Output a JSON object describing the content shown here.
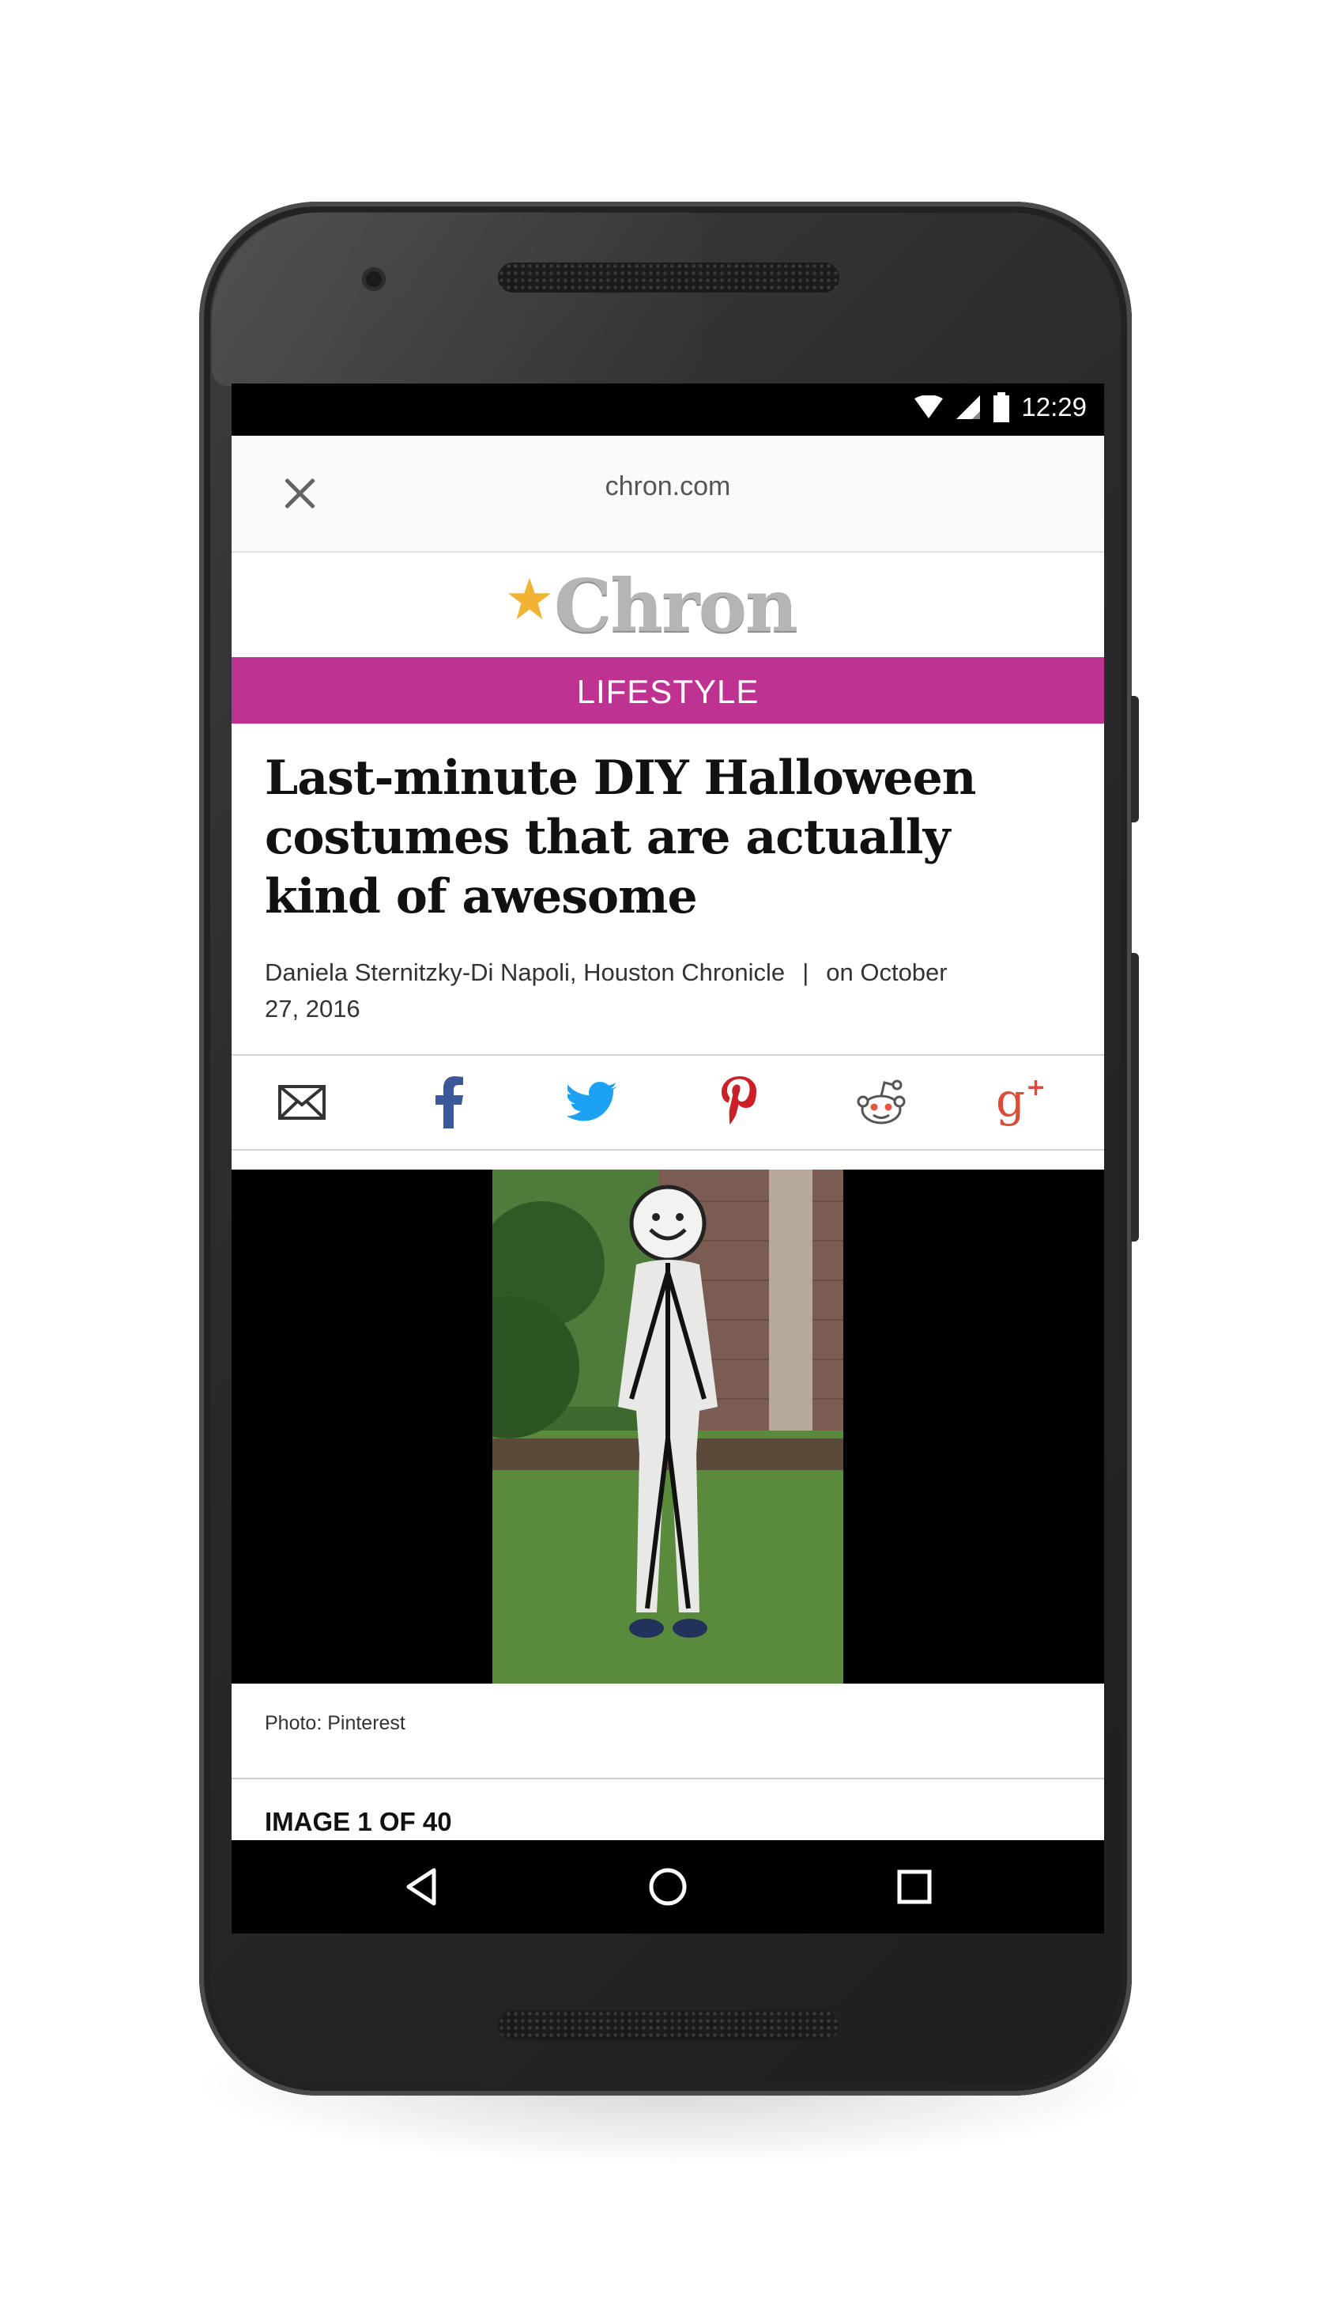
{
  "status_bar": {
    "time": "12:29"
  },
  "browser": {
    "url": "chron.com"
  },
  "site": {
    "logo_text": "Chron",
    "section": "LIFESTYLE",
    "section_color": "#be3391"
  },
  "article": {
    "headline": "Last-minute DIY Halloween costumes that are actually kind of awesome",
    "author": "Daniela Sternitzky-Di Napoli, Houston Chronicle",
    "separator": "|",
    "date_prefix": "on October",
    "date_rest": "27, 2016"
  },
  "share": [
    {
      "icon": "email-icon",
      "color": "#333333"
    },
    {
      "icon": "facebook-icon",
      "color": "#3b5998"
    },
    {
      "icon": "twitter-icon",
      "color": "#1da1f2"
    },
    {
      "icon": "pinterest-icon",
      "color": "#cb2027"
    },
    {
      "icon": "reddit-icon",
      "color": "#555555"
    },
    {
      "icon": "google-plus-icon",
      "color": "#dd4b39"
    }
  ],
  "gallery": {
    "caption": "Photo: Pinterest",
    "count": "IMAGE 1 OF 40"
  },
  "nav": [
    "back-icon",
    "home-icon",
    "recents-icon"
  ]
}
